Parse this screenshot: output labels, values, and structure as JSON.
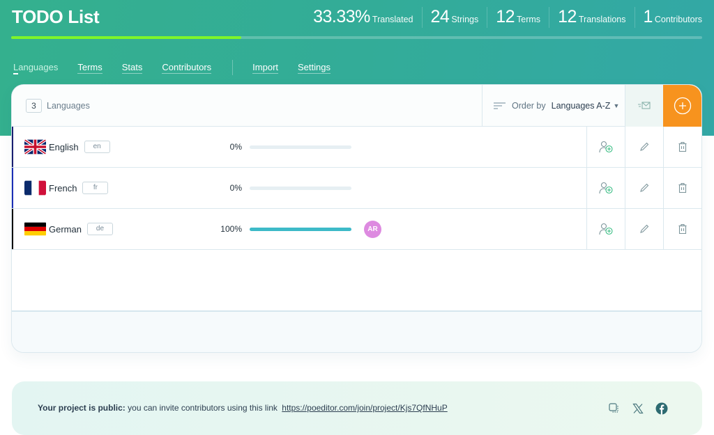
{
  "project": {
    "title": "TODO List",
    "progress_percent": 33.33
  },
  "stats": [
    {
      "value": "33.33%",
      "label": "Translated"
    },
    {
      "value": "24",
      "label": "Strings"
    },
    {
      "value": "12",
      "label": "Terms"
    },
    {
      "value": "12",
      "label": "Translations"
    },
    {
      "value": "1",
      "label": "Contributors"
    }
  ],
  "nav": {
    "tabs": [
      {
        "label": "Languages",
        "active": true
      },
      {
        "label": "Terms"
      },
      {
        "label": "Stats"
      },
      {
        "label": "Contributors"
      }
    ],
    "tabs2": [
      {
        "label": "Import"
      },
      {
        "label": "Settings"
      }
    ]
  },
  "languages_panel": {
    "count": "3",
    "count_label": "Languages",
    "order_label": "Order by",
    "order_value": "Languages A-Z",
    "icons": {
      "order": "sort-lines-icon",
      "notify": "send-mail-icon",
      "add": "plus-circle-icon"
    },
    "colors": {
      "add_button": "#f7931e",
      "progress_fill": "#3dbac8",
      "header_progress": "#7ef52a"
    }
  },
  "languages": [
    {
      "name": "English",
      "code": "en",
      "percent_label": "0%",
      "progress": 0,
      "flag": "uk-flag",
      "accent": "#1a1f71",
      "contributor": ""
    },
    {
      "name": "French",
      "code": "fr",
      "percent_label": "0%",
      "progress": 0,
      "flag": "france-flag",
      "accent": "#1c2fb4",
      "contributor": ""
    },
    {
      "name": "German",
      "code": "de",
      "percent_label": "100%",
      "progress": 100,
      "flag": "germany-flag",
      "accent": "#000000",
      "contributor": "AR"
    }
  ],
  "row_actions": [
    "add-contributor-icon",
    "edit-pencil-icon",
    "trash-icon"
  ],
  "banner": {
    "bold": "Your project is public:",
    "text": "you can invite contributors using this link",
    "link": "https://poeditor.com/join/project/Kjs7QfNHuP",
    "icons": [
      "copy-icon",
      "x-twitter-icon",
      "facebook-icon"
    ]
  }
}
